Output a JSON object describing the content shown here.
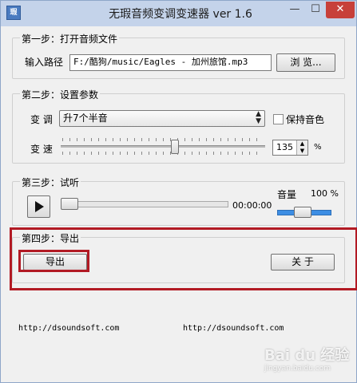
{
  "window": {
    "title": "无瑕音频变调变速器 ver 1.6",
    "icon_label": "瑕",
    "min_glyph": "—",
    "max_glyph": "☐",
    "close_glyph": "✕"
  },
  "step1": {
    "title": "第一步：打开音频文件",
    "path_label": "输入路径",
    "path_value": "F:/酷狗/music/Eagles - 加州旅馆.mp3",
    "browse_label": "浏 览..."
  },
  "step2": {
    "title": "第二步：设置参数",
    "pitch_label": "变 调",
    "pitch_value": "升7个半音",
    "keep_tone_label": "保持音色",
    "speed_label": "变 速",
    "speed_value": "135",
    "speed_unit": "%",
    "speed_fraction": 0.56
  },
  "step3": {
    "title": "第三步：试听",
    "time": "00:00:00",
    "volume_label": "音量",
    "volume_value": "100 %",
    "progress_fraction": 0.0
  },
  "step4": {
    "title": "第四步：导出",
    "export_label": "导出",
    "about_label": "关 于"
  },
  "footer": {
    "link_left": "http://dsoundsoft.com",
    "link_right": "http://dsoundsoft.com"
  },
  "watermark": {
    "main": "Bai du 经验",
    "sub": "jingyan.baidu.com"
  },
  "colors": {
    "highlight": "#b21a24",
    "accent": "#3d8ee4"
  }
}
